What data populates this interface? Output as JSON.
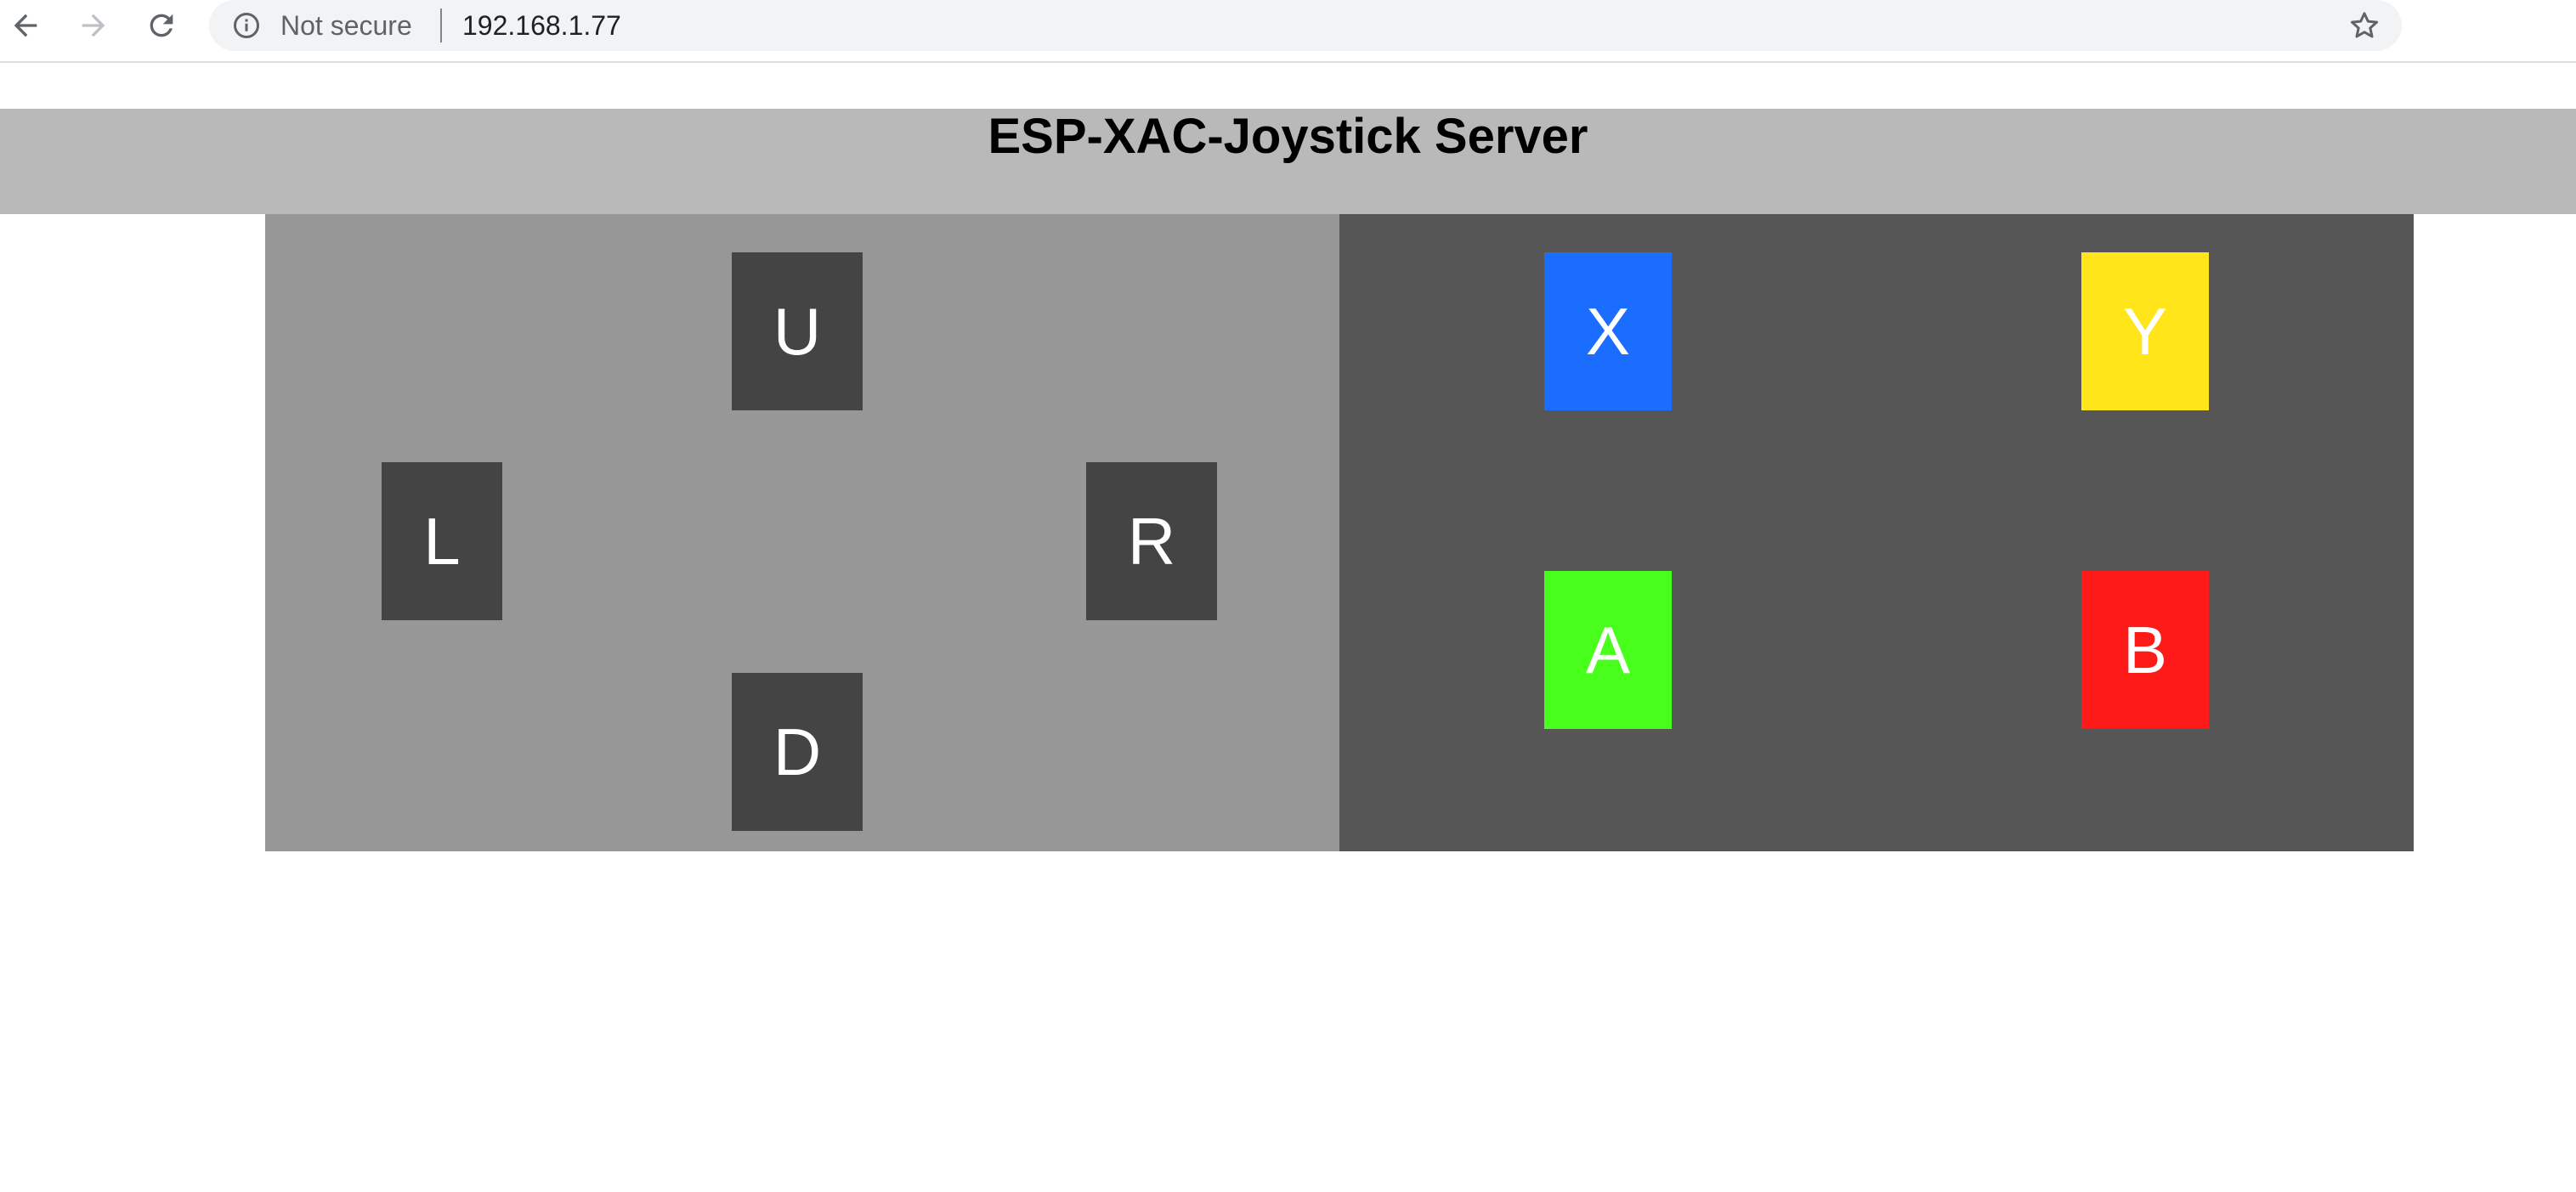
{
  "browser": {
    "security_label": "Not secure",
    "url": "192.168.1.77"
  },
  "page": {
    "title": "ESP-XAC-Joystick Server"
  },
  "dpad": {
    "up_label": "U",
    "left_label": "L",
    "right_label": "R",
    "down_label": "D"
  },
  "face_buttons": {
    "x_label": "X",
    "y_label": "Y",
    "a_label": "A",
    "b_label": "B"
  },
  "colors": {
    "header_bg": "#b9b9b9",
    "dpad_panel_bg": "#979797",
    "face_panel_bg": "#565656",
    "dir_button_bg": "#444444",
    "x_button": "#1a6dff",
    "y_button": "#ffe519",
    "a_button": "#47ff1a",
    "b_button": "#ff1a1a"
  }
}
